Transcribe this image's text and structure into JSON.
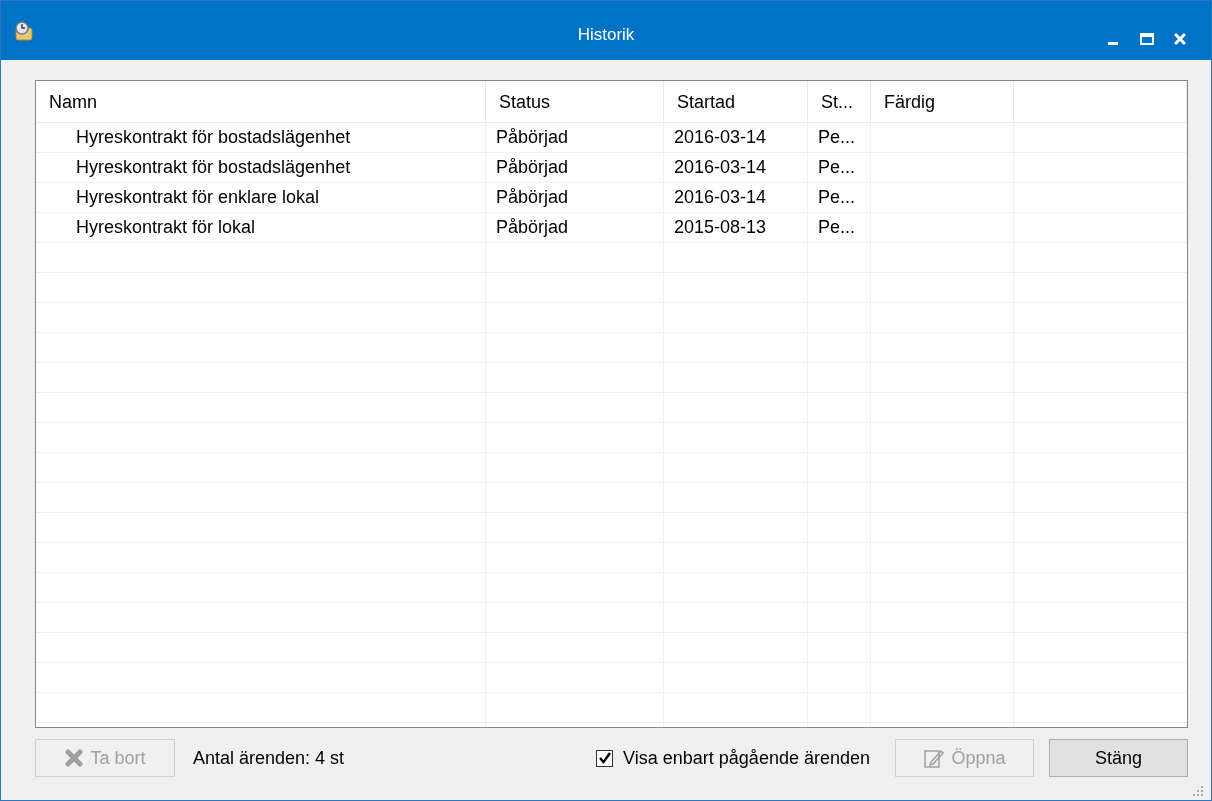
{
  "window": {
    "title": "Historik"
  },
  "table": {
    "columns": [
      "Namn",
      "Status",
      "Startad",
      "St...",
      "Färdig"
    ],
    "rows": [
      [
        "Hyreskontrakt för bostadslägenhet",
        "Påbörjad",
        "2016-03-14",
        "Pe..."
      ],
      [
        "Hyreskontrakt för bostadslägenhet",
        "Påbörjad",
        "2016-03-14",
        "Pe..."
      ],
      [
        "Hyreskontrakt för enklare lokal",
        "Påbörjad",
        "2016-03-14",
        "Pe..."
      ],
      [
        "Hyreskontrakt för lokal",
        "Påbörjad",
        "2015-08-13",
        "Pe..."
      ]
    ]
  },
  "footer": {
    "delete_button": {
      "label": "Ta bort",
      "disabled": true
    },
    "count": "Antal ärenden: 4 st",
    "filter": {
      "label": "Visa enbart pågående ärenden",
      "checked": true
    },
    "open_button": {
      "label": "Öppna",
      "disabled": true
    },
    "close_button": {
      "label": "Stäng",
      "disabled": false
    }
  }
}
